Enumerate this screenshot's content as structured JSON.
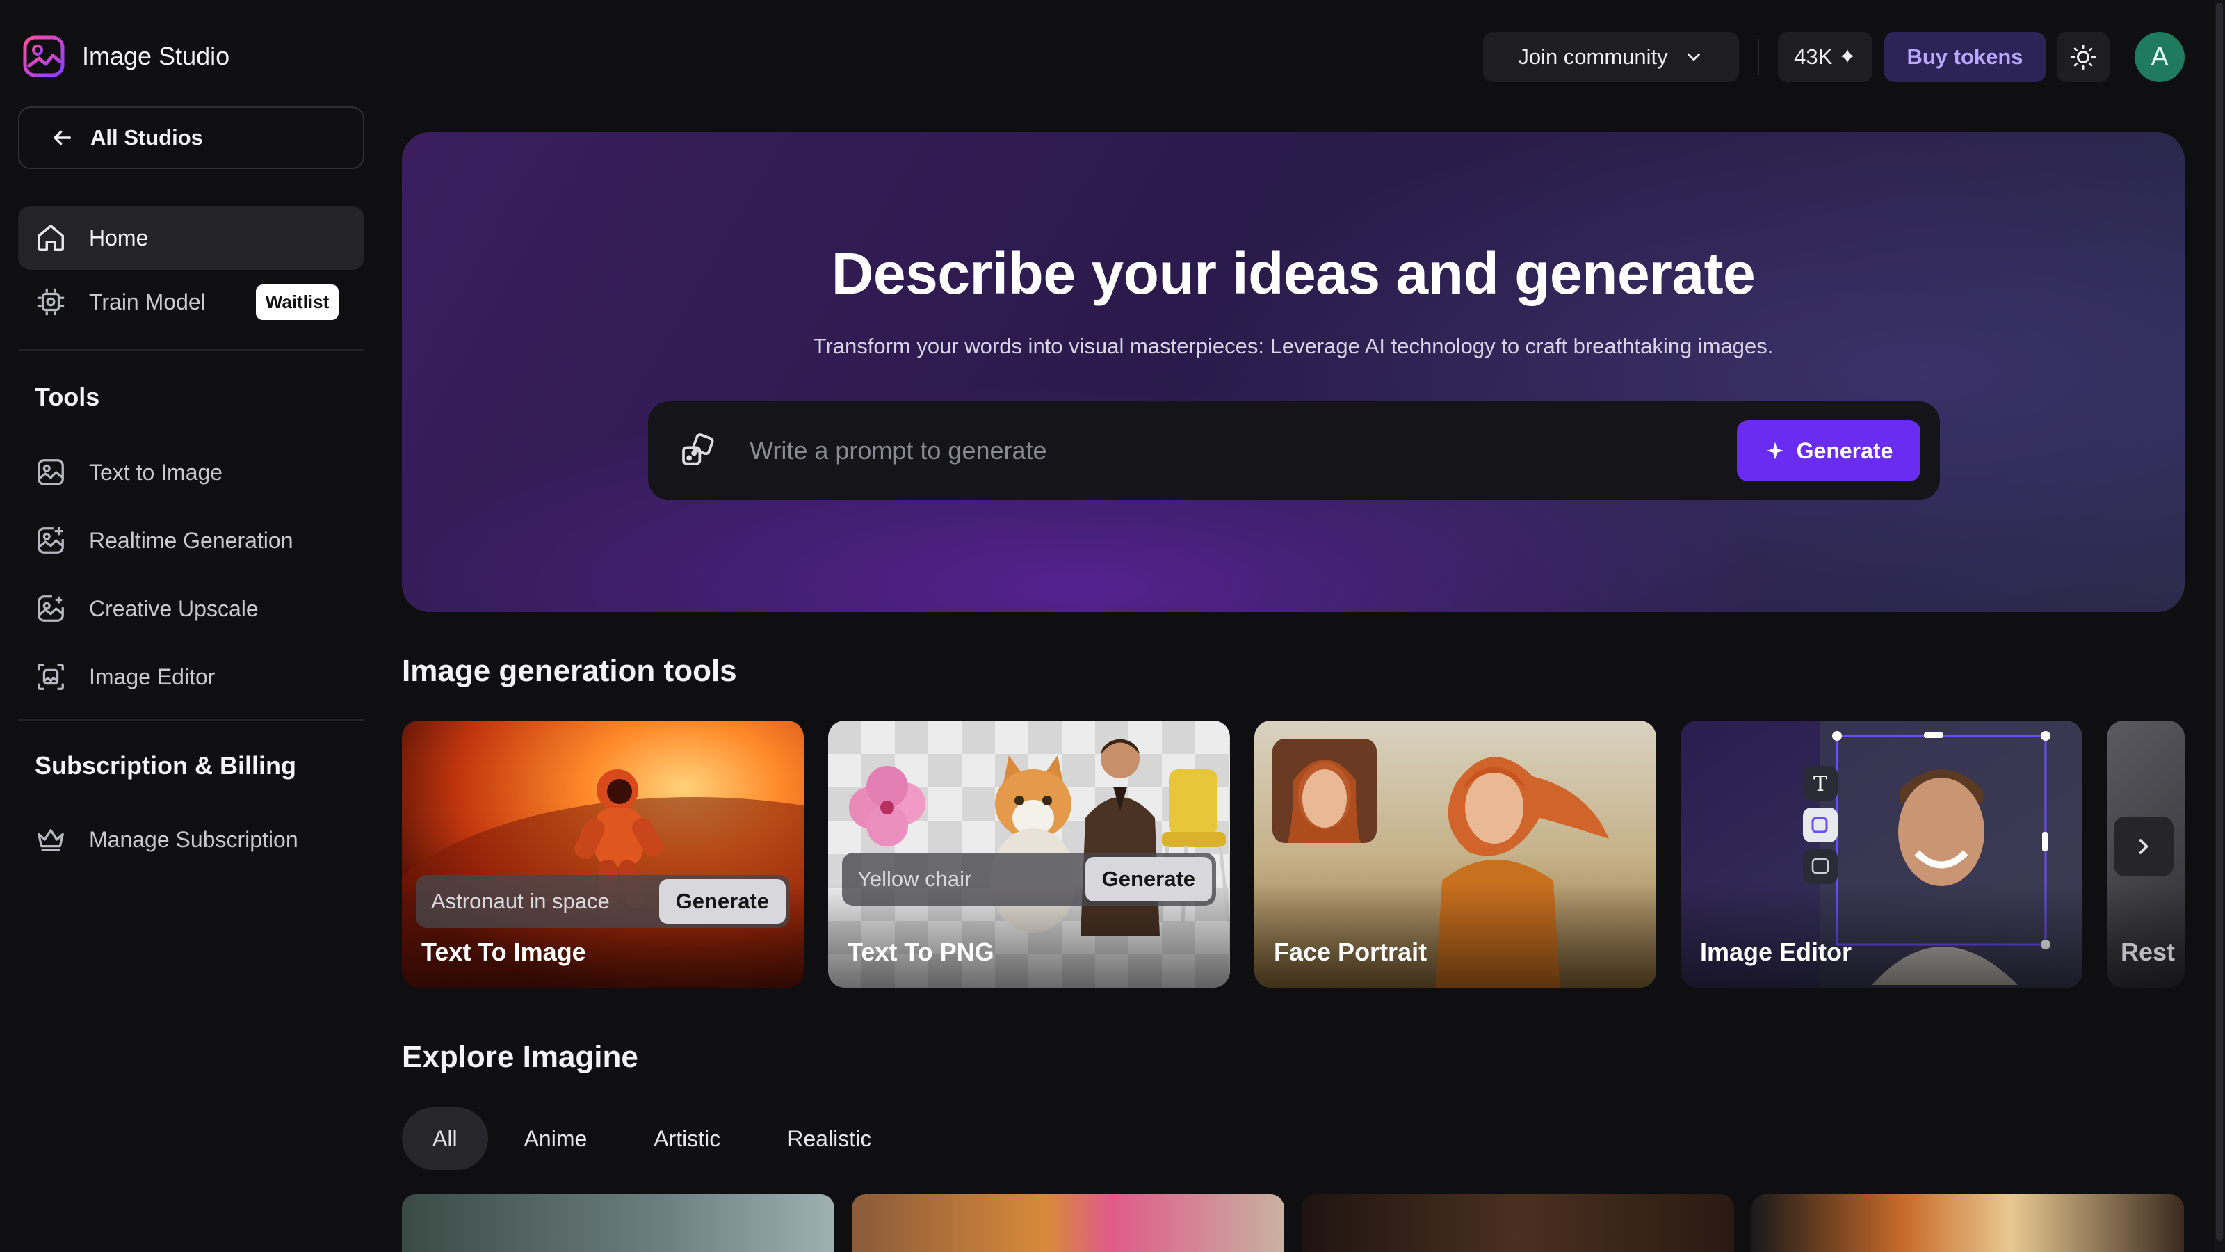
{
  "app": {
    "name": "Image Studio"
  },
  "sidebar": {
    "back_label": "All Studios",
    "main_items": [
      {
        "label": "Home",
        "icon": "home-icon",
        "active": true
      },
      {
        "label": "Train Model",
        "icon": "cpu-icon",
        "badge": "Waitlist"
      }
    ],
    "tools_heading": "Tools",
    "tools": [
      {
        "label": "Text to Image",
        "icon": "image-icon"
      },
      {
        "label": "Realtime Generation",
        "icon": "image-sparkle-icon"
      },
      {
        "label": "Creative Upscale",
        "icon": "image-plus-icon"
      },
      {
        "label": "Image Editor",
        "icon": "image-frame-icon"
      }
    ],
    "billing_heading": "Subscription & Billing",
    "billing": [
      {
        "label": "Manage Subscription",
        "icon": "crown-icon"
      }
    ]
  },
  "topbar": {
    "community_label": "Join community",
    "tokens": "43K ✦",
    "buy_label": "Buy tokens",
    "avatar_initial": "A"
  },
  "hero": {
    "title": "Describe your ideas and generate",
    "subtitle": "Transform your words into visual masterpieces: Leverage AI technology to craft breathtaking images.",
    "prompt_placeholder": "Write a prompt to generate",
    "generate_label": "Generate"
  },
  "tools_section": {
    "heading": "Image generation tools",
    "cards": [
      {
        "title": "Text To Image",
        "prompt": "Astronaut in space",
        "button": "Generate"
      },
      {
        "title": "Text To PNG",
        "prompt": "Yellow chair",
        "button": "Generate"
      },
      {
        "title": "Face Portrait"
      },
      {
        "title": "Image Editor"
      },
      {
        "title": "Rest"
      }
    ]
  },
  "explore": {
    "heading": "Explore Imagine",
    "filters": [
      "All",
      "Anime",
      "Artistic",
      "Realistic"
    ],
    "active_filter": "All"
  },
  "colors": {
    "accent": "#6a2cf0",
    "buy_tokens_bg": "#2c2457",
    "buy_tokens_text": "#b9a8ff",
    "avatar_bg": "#1f7a5e"
  }
}
